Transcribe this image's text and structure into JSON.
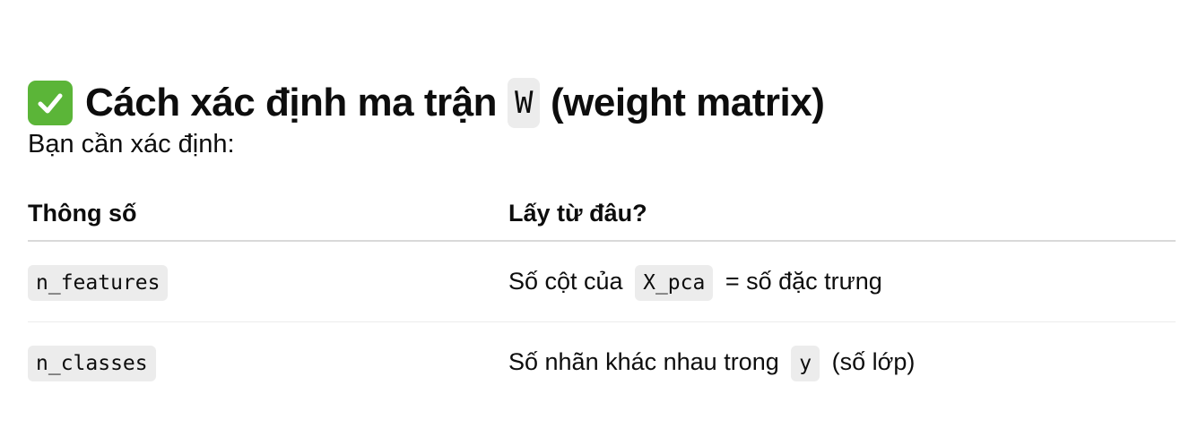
{
  "heading": {
    "icon": "check-mark-button-icon",
    "icon_color": "#5bb538",
    "prefix": "Cách xác định ma trận",
    "code": "W",
    "suffix": "(weight matrix)"
  },
  "intro": "Bạn cần xác định:",
  "table": {
    "headers": [
      "Thông số",
      "Lấy từ đâu?"
    ],
    "rows": [
      {
        "param": "n_features",
        "source_before": "Số cột của",
        "source_code": "X_pca",
        "source_after": "= số đặc trưng"
      },
      {
        "param": "n_classes",
        "source_before": "Số nhãn khác nhau trong",
        "source_code": "y",
        "source_after": "(số lớp)"
      }
    ]
  }
}
